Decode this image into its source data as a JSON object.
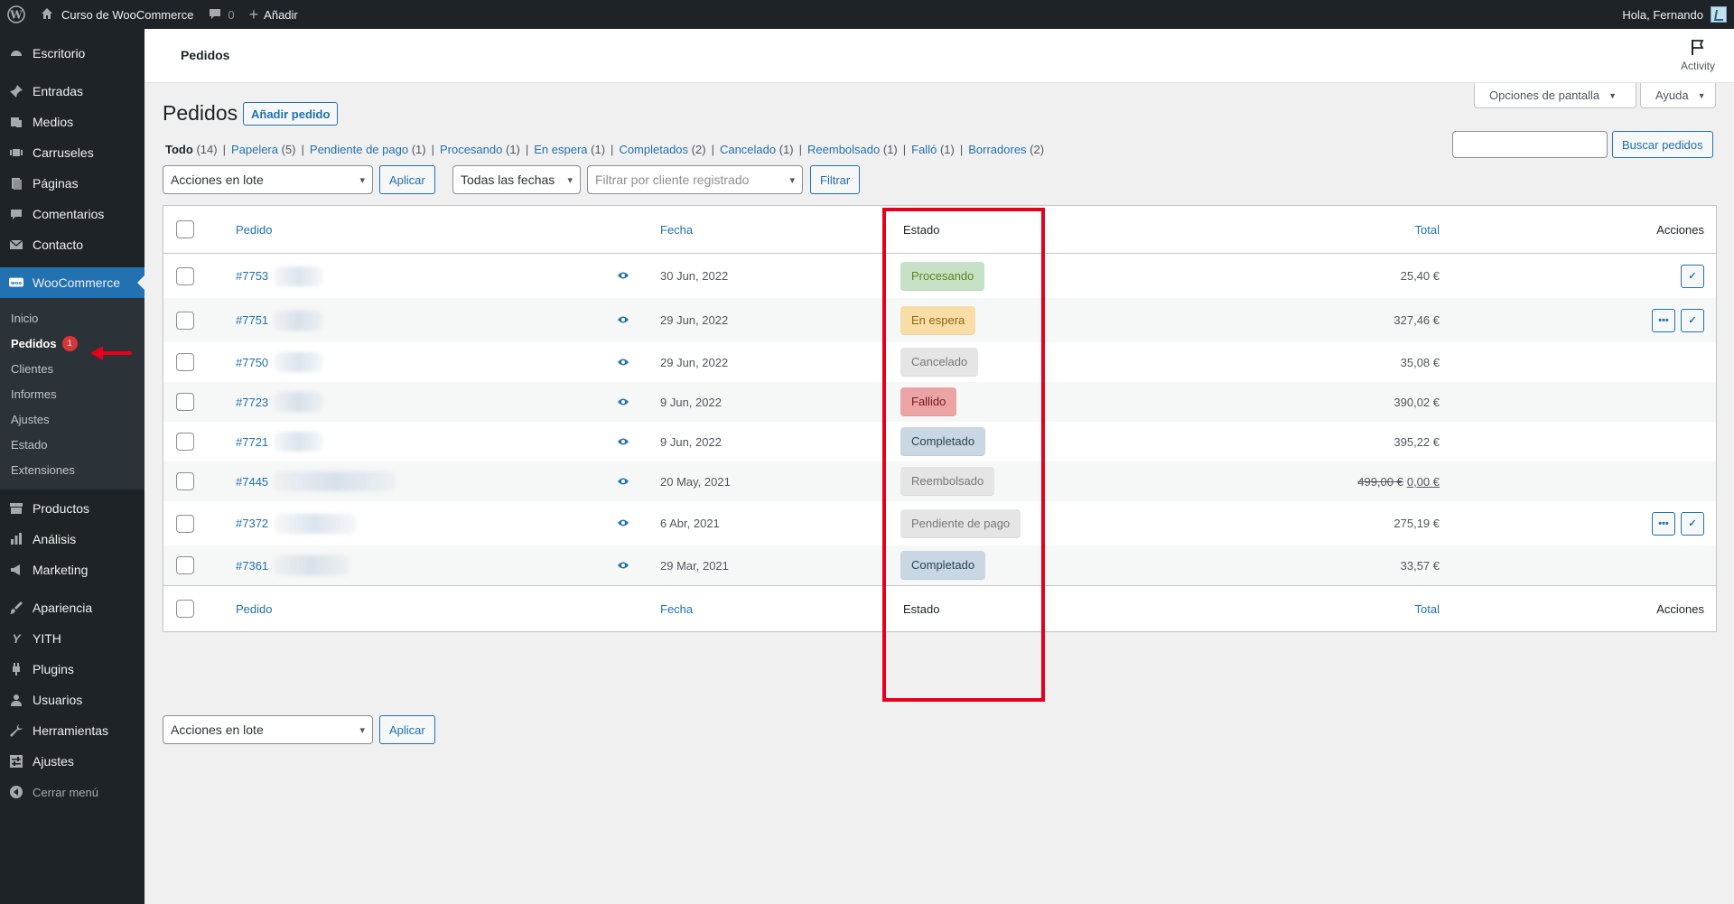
{
  "admin_bar": {
    "site_name": "Curso de WooCommerce",
    "comments_count": "0",
    "new_label": "Añadir",
    "greeting": "Hola, Fernando"
  },
  "sidebar": {
    "top": [
      {
        "label": "Escritorio",
        "icon": "dashboard-icon"
      }
    ],
    "group1": [
      {
        "label": "Entradas",
        "icon": "pin-icon"
      },
      {
        "label": "Medios",
        "icon": "media-icon"
      },
      {
        "label": "Carruseles",
        "icon": "carousel-icon"
      },
      {
        "label": "Páginas",
        "icon": "pages-icon"
      },
      {
        "label": "Comentarios",
        "icon": "comment-icon"
      },
      {
        "label": "Contacto",
        "icon": "mail-icon"
      }
    ],
    "woocommerce": {
      "label": "WooCommerce",
      "icon": "woo-icon"
    },
    "submenu": [
      {
        "label": "Inicio"
      },
      {
        "label": "Pedidos",
        "badge": "1"
      },
      {
        "label": "Clientes"
      },
      {
        "label": "Informes"
      },
      {
        "label": "Ajustes"
      },
      {
        "label": "Estado"
      },
      {
        "label": "Extensiones"
      }
    ],
    "group2": [
      {
        "label": "Productos",
        "icon": "archive-icon"
      },
      {
        "label": "Análisis",
        "icon": "chart-icon"
      },
      {
        "label": "Marketing",
        "icon": "megaphone-icon"
      }
    ],
    "group3": [
      {
        "label": "Apariencia",
        "icon": "brush-icon"
      },
      {
        "label": "YITH",
        "icon": "yith-icon"
      },
      {
        "label": "Plugins",
        "icon": "plugin-icon"
      },
      {
        "label": "Usuarios",
        "icon": "users-icon"
      },
      {
        "label": "Herramientas",
        "icon": "wrench-icon"
      },
      {
        "label": "Ajustes",
        "icon": "settings-icon"
      },
      {
        "label": "Cerrar menú",
        "icon": "collapse-icon"
      }
    ]
  },
  "header": {
    "title": "Pedidos",
    "activity_label": "Activity"
  },
  "screen_options": {
    "screen_label": "Opciones de pantalla",
    "help_label": "Ayuda"
  },
  "page": {
    "title": "Pedidos",
    "add_order": "Añadir pedido",
    "search_button": "Buscar pedidos"
  },
  "views": [
    {
      "label": "Todo",
      "count": "(14)",
      "current": true
    },
    {
      "label": "Papelera",
      "count": "(5)"
    },
    {
      "label": "Pendiente de pago",
      "count": "(1)"
    },
    {
      "label": "Procesando",
      "count": "(1)"
    },
    {
      "label": "En espera",
      "count": "(1)"
    },
    {
      "label": "Completados",
      "count": "(2)"
    },
    {
      "label": "Cancelado",
      "count": "(1)"
    },
    {
      "label": "Reembolsado",
      "count": "(1)"
    },
    {
      "label": "Falló",
      "count": "(1)"
    },
    {
      "label": "Borradores",
      "count": "(2)"
    }
  ],
  "tablenav": {
    "bulk_actions": "Acciones en lote",
    "apply": "Aplicar",
    "dates": "Todas las fechas",
    "customer_placeholder": "Filtrar por cliente registrado",
    "filter": "Filtrar"
  },
  "columns": {
    "order": "Pedido",
    "date": "Fecha",
    "status": "Estado",
    "total": "Total",
    "actions": "Acciones"
  },
  "orders": [
    {
      "number": "#7753",
      "date": "30 Jun, 2022",
      "status": "Procesando",
      "status_key": "processing",
      "total": "25,40 €",
      "actions": [
        "complete"
      ]
    },
    {
      "number": "#7751",
      "date": "29 Jun, 2022",
      "status": "En espera",
      "status_key": "on-hold",
      "total": "327,46 €",
      "actions": [
        "processing",
        "complete"
      ]
    },
    {
      "number": "#7750",
      "date": "29 Jun, 2022",
      "status": "Cancelado",
      "status_key": "cancelled",
      "total": "35,08 €",
      "actions": []
    },
    {
      "number": "#7723",
      "date": "9 Jun, 2022",
      "status": "Fallido",
      "status_key": "failed",
      "total": "390,02 €",
      "actions": []
    },
    {
      "number": "#7721",
      "date": "9 Jun, 2022",
      "status": "Completado",
      "status_key": "completed",
      "total": "395,22 €",
      "actions": []
    },
    {
      "number": "#7445",
      "date": "20 May, 2021",
      "status": "Reembolsado",
      "status_key": "refunded",
      "total_original": "499,00 €",
      "total": "0,00 €",
      "actions": []
    },
    {
      "number": "#7372",
      "date": "6 Abr, 2021",
      "status": "Pendiente de pago",
      "status_key": "pending",
      "total": "275,19 €",
      "actions": [
        "processing",
        "complete"
      ]
    },
    {
      "number": "#7361",
      "date": "29 Mar, 2021",
      "status": "Completado",
      "status_key": "completed",
      "total": "33,57 €",
      "actions": []
    }
  ],
  "colors": {
    "accent": "#2271b1",
    "highlight": "#e5001c",
    "admin_bg": "#1d2327"
  }
}
